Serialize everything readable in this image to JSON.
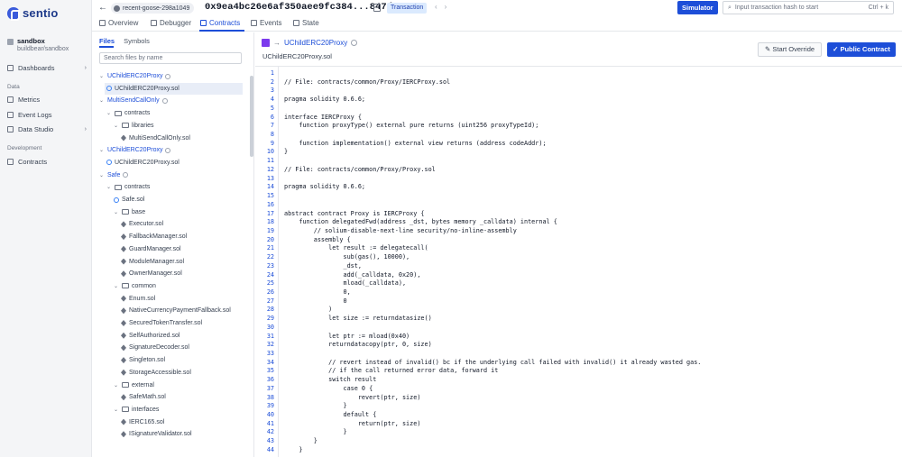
{
  "app": {
    "logo": "sentio"
  },
  "project": {
    "name": "sandbox",
    "path": "buildbear/sandbox"
  },
  "nav": {
    "dashboards": "Dashboards",
    "data_section": "Data",
    "metrics": "Metrics",
    "event_logs": "Event Logs",
    "data_studio": "Data Studio",
    "development_section": "Development",
    "contracts": "Contracts"
  },
  "topbar": {
    "fork": "recent-goose-298a1049",
    "hash": "0x9ea4bc26e6af350aee9fc384...847d",
    "badge": "Transaction",
    "simulator": "Simulator",
    "search_placeholder": "Input transaction hash to start",
    "shortcut": "Ctrl + k"
  },
  "tabs": [
    "Overview",
    "Debugger",
    "Contracts",
    "Events",
    "State"
  ],
  "files_panel": {
    "tab_files": "Files",
    "tab_symbols": "Symbols",
    "search_placeholder": "Search files by name",
    "tree": [
      {
        "label": "UChildERC20Proxy",
        "kind": "contract",
        "indent": 0,
        "info": true
      },
      {
        "label": "UChildERC20Proxy.sol",
        "kind": "main",
        "indent": 1,
        "selected": true
      },
      {
        "label": "MultiSendCallOnly",
        "kind": "contract",
        "indent": 0,
        "info": true
      },
      {
        "label": "contracts",
        "kind": "folder",
        "indent": 1
      },
      {
        "label": "libraries",
        "kind": "folder",
        "indent": 2
      },
      {
        "label": "MultiSendCallOnly.sol",
        "kind": "sol",
        "indent": 3
      },
      {
        "label": "UChildERC20Proxy",
        "kind": "contract",
        "indent": 0,
        "info": true
      },
      {
        "label": "UChildERC20Proxy.sol",
        "kind": "main",
        "indent": 1
      },
      {
        "label": "Safe",
        "kind": "contract",
        "indent": 0,
        "info": true
      },
      {
        "label": "contracts",
        "kind": "folder",
        "indent": 1
      },
      {
        "label": "Safe.sol",
        "kind": "main",
        "indent": 2
      },
      {
        "label": "base",
        "kind": "folder",
        "indent": 2
      },
      {
        "label": "Executor.sol",
        "kind": "sol",
        "indent": 3
      },
      {
        "label": "FallbackManager.sol",
        "kind": "sol",
        "indent": 3
      },
      {
        "label": "GuardManager.sol",
        "kind": "sol",
        "indent": 3
      },
      {
        "label": "ModuleManager.sol",
        "kind": "sol",
        "indent": 3
      },
      {
        "label": "OwnerManager.sol",
        "kind": "sol",
        "indent": 3
      },
      {
        "label": "common",
        "kind": "folder",
        "indent": 2
      },
      {
        "label": "Enum.sol",
        "kind": "sol",
        "indent": 3
      },
      {
        "label": "NativeCurrencyPaymentFallback.sol",
        "kind": "sol",
        "indent": 3
      },
      {
        "label": "SecuredTokenTransfer.sol",
        "kind": "sol",
        "indent": 3
      },
      {
        "label": "SelfAuthorized.sol",
        "kind": "sol",
        "indent": 3
      },
      {
        "label": "SignatureDecoder.sol",
        "kind": "sol",
        "indent": 3
      },
      {
        "label": "Singleton.sol",
        "kind": "sol",
        "indent": 3
      },
      {
        "label": "StorageAccessible.sol",
        "kind": "sol",
        "indent": 3
      },
      {
        "label": "external",
        "kind": "folder",
        "indent": 2
      },
      {
        "label": "SafeMath.sol",
        "kind": "sol",
        "indent": 3
      },
      {
        "label": "interfaces",
        "kind": "folder",
        "indent": 2
      },
      {
        "label": "IERC165.sol",
        "kind": "sol",
        "indent": 3
      },
      {
        "label": "ISignatureValidator.sol",
        "kind": "sol",
        "indent": 3
      }
    ]
  },
  "code_panel": {
    "contract": "UChildERC20Proxy",
    "file": "UChildERC20Proxy.sol",
    "start_override": "Start Override",
    "public_contract": "Public Contract",
    "lines": [
      "",
      "// File: contracts/common/Proxy/IERCProxy.sol",
      "",
      "pragma solidity 0.6.6;",
      "",
      "interface IERCProxy {",
      "    function proxyType() external pure returns (uint256 proxyTypeId);",
      "",
      "    function implementation() external view returns (address codeAddr);",
      "}",
      "",
      "// File: contracts/common/Proxy/Proxy.sol",
      "",
      "pragma solidity 0.6.6;",
      "",
      "",
      "abstract contract Proxy is IERCProxy {",
      "    function delegatedFwd(address _dst, bytes memory _calldata) internal {",
      "        // solium-disable-next-line security/no-inline-assembly",
      "        assembly {",
      "            let result := delegatecall(",
      "                sub(gas(), 10000),",
      "                _dst,",
      "                add(_calldata, 0x20),",
      "                mload(_calldata),",
      "                0,",
      "                0",
      "            )",
      "            let size := returndatasize()",
      "",
      "            let ptr := mload(0x40)",
      "            returndatacopy(ptr, 0, size)",
      "",
      "            // revert instead of invalid() bc if the underlying call failed with invalid() it already wasted gas.",
      "            // if the call returned error data, forward it",
      "            switch result",
      "                case 0 {",
      "                    revert(ptr, size)",
      "                }",
      "                default {",
      "                    return(ptr, size)",
      "                }",
      "        }",
      "    }"
    ]
  }
}
